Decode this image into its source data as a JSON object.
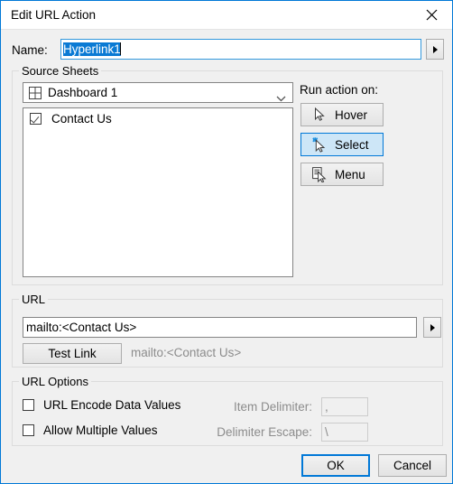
{
  "window": {
    "title": "Edit URL Action",
    "close_icon": "close-icon"
  },
  "name_field": {
    "label": "Name:",
    "value": "Hyperlink1",
    "selected": true,
    "arrow_icon": "triangle-right-icon"
  },
  "source_sheets": {
    "group_title": "Source Sheets",
    "dropdown": {
      "value": "Dashboard 1",
      "icon": "dashboard-grid-icon",
      "chevron_icon": "chevron-down-icon"
    },
    "sheets": [
      {
        "label": "Contact Us",
        "checked": true
      }
    ]
  },
  "run_action": {
    "label": "Run action on:",
    "buttons": [
      {
        "label": "Hover",
        "icon": "cursor-arrow-icon",
        "selected": false
      },
      {
        "label": "Select",
        "icon": "cursor-select-sparkle-icon",
        "selected": true
      },
      {
        "label": "Menu",
        "icon": "cursor-menu-list-icon",
        "selected": false
      }
    ]
  },
  "url": {
    "group_title": "URL",
    "value": "mailto:<Contact Us>",
    "arrow_icon": "triangle-right-icon",
    "test_link_label": "Test Link",
    "preview": "mailto:<Contact Us>"
  },
  "url_options": {
    "group_title": "URL Options",
    "checkboxes": [
      {
        "label": "URL Encode Data Values",
        "checked": false
      },
      {
        "label": "Allow Multiple Values",
        "checked": false
      }
    ],
    "item_delimiter": {
      "label": "Item Delimiter:",
      "value": ",",
      "disabled": true
    },
    "delimiter_escape": {
      "label": "Delimiter Escape:",
      "value": "\\",
      "disabled": true
    }
  },
  "footer": {
    "ok_label": "OK",
    "cancel_label": "Cancel"
  },
  "colors": {
    "accent": "#0078d7",
    "selection": "#0a7ad4",
    "selected_button_fill": "#cde6f7",
    "dialog_bg": "#f0f0f0",
    "disabled_text": "#8c8c8c"
  }
}
